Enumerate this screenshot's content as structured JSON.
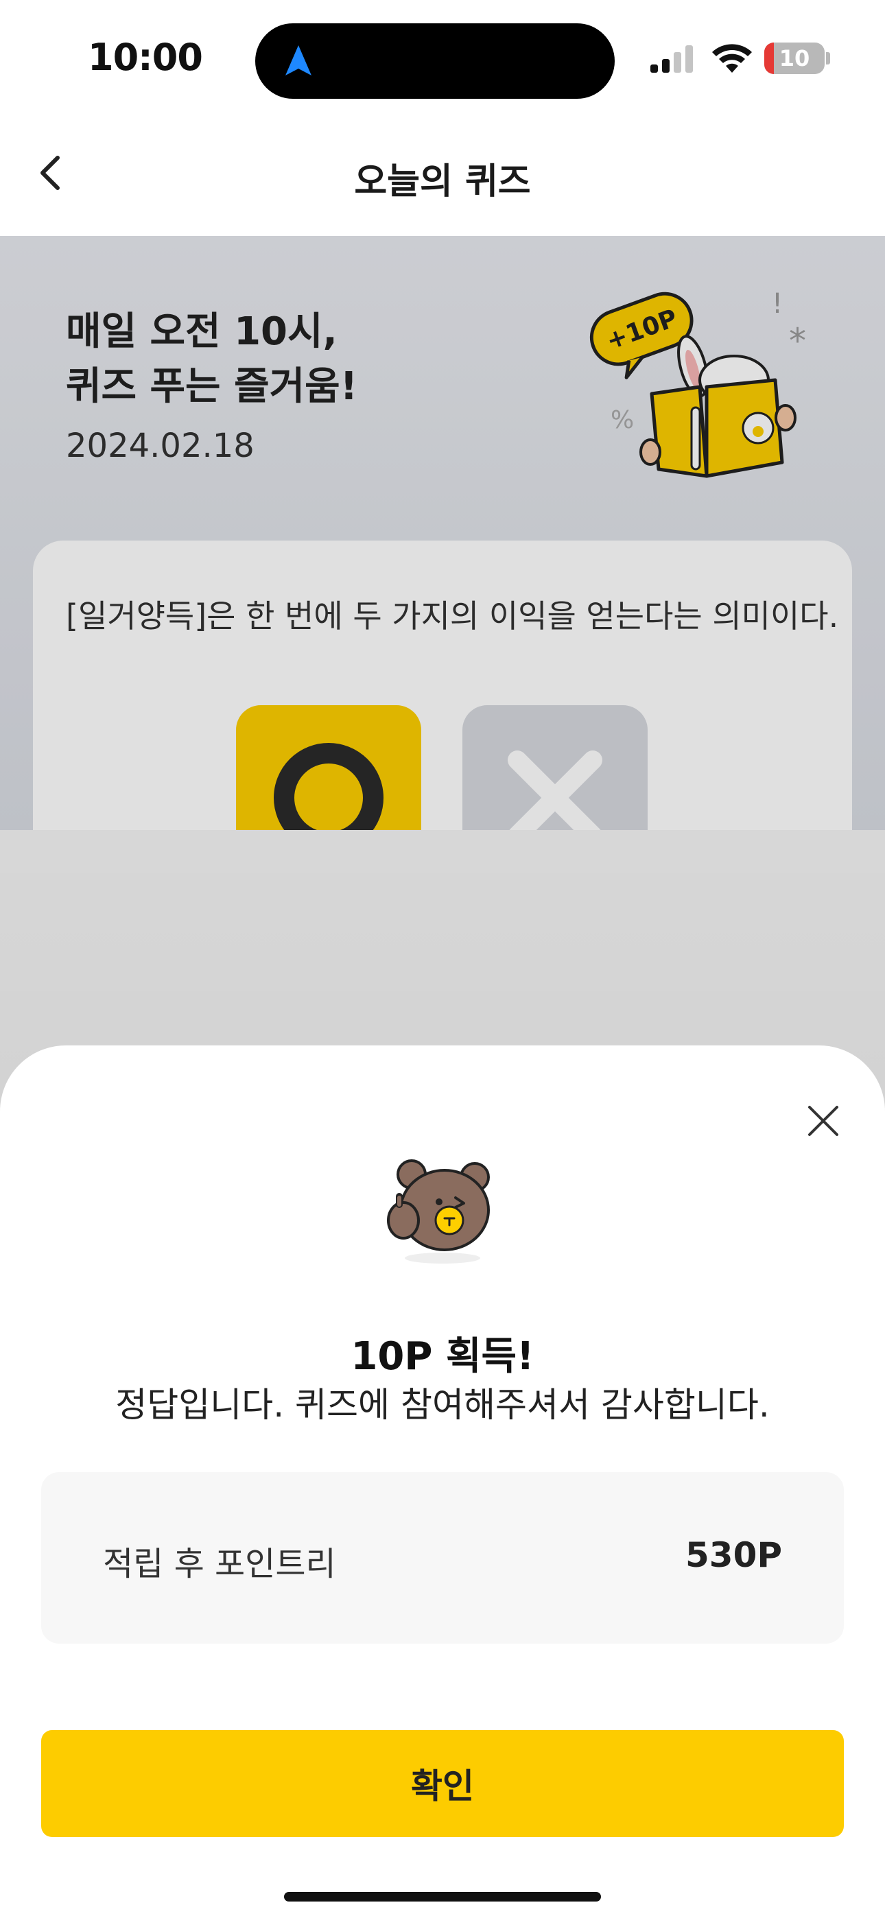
{
  "status_bar": {
    "time": "10:00",
    "battery_level": "10"
  },
  "header": {
    "title": "오늘의 퀴즈"
  },
  "hero": {
    "title_line1": "매일 오전 10시,",
    "title_line2": "퀴즈 푸는 즐거움!",
    "date": "2024.02.18",
    "badge": "+10P"
  },
  "quiz": {
    "question": "[일거양득]은 한 번에 두 가지의 이익을 얻는다는 의미이다.",
    "selected": "O"
  },
  "result_sheet": {
    "title": "10P 획득!",
    "message": "정답입니다. 퀴즈에 참여해주셔서 감사합니다.",
    "points_label": "적립 후 포인트리",
    "points_value": "530P",
    "confirm_label": "확인"
  },
  "colors": {
    "accent": "#fdcc00",
    "dark": "#2b2b2b",
    "x_gray": "#d6d9de"
  },
  "icons": [
    "navigation-arrow-icon",
    "signal-icon",
    "wifi-icon",
    "battery-icon",
    "back-chevron-icon",
    "close-icon",
    "bear-thumbs-up-icon",
    "rabbit-book-illustration"
  ]
}
